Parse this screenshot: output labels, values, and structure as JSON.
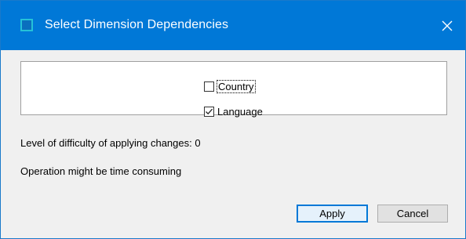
{
  "window": {
    "title": "Select Dimension Dependencies",
    "close_glyph": "✕"
  },
  "dimensions": [
    {
      "label": "Country",
      "checked": false,
      "focused": true
    },
    {
      "label": "Language",
      "checked": true,
      "focused": false
    }
  ],
  "info": {
    "difficulty": "Level of difficulty of applying changes: 0",
    "warning": "Operation might be time consuming"
  },
  "buttons": {
    "apply": "Apply",
    "cancel": "Cancel"
  },
  "colors": {
    "titlebar": "#0078d7",
    "default_button_border": "#0078d7"
  },
  "icons": {
    "app": "window-icon",
    "close": "close-icon",
    "check": "checkmark-icon"
  }
}
